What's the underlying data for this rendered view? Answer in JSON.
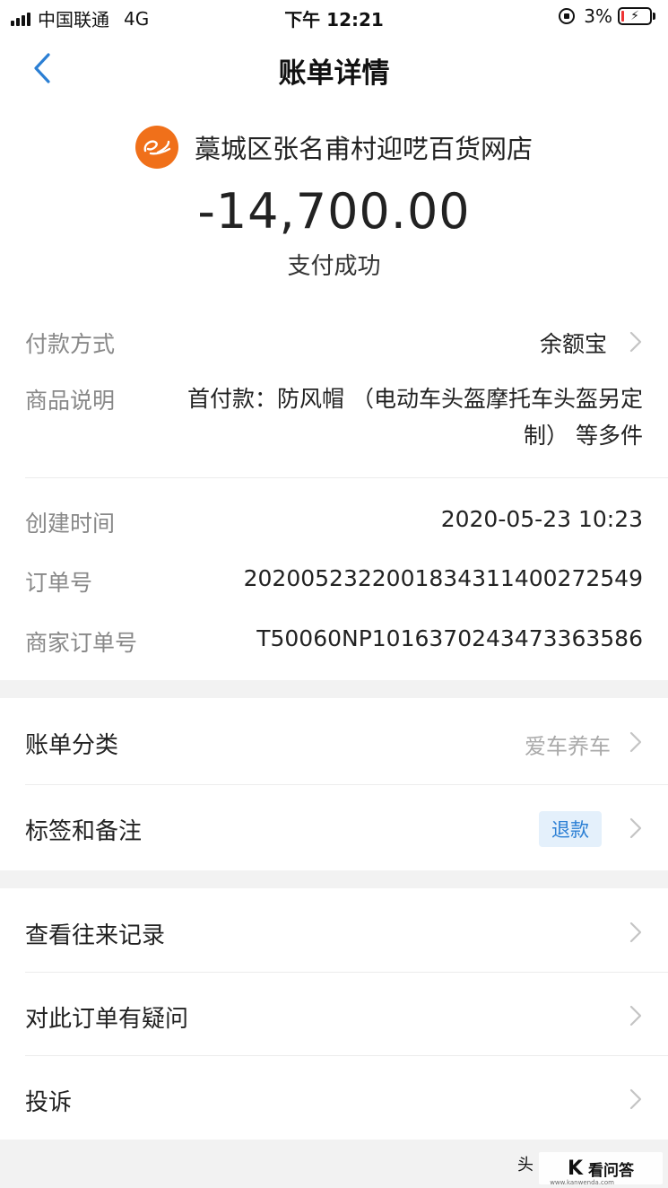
{
  "status_bar": {
    "carrier": "中国联通",
    "network": "4G",
    "time": "下午 12:21",
    "battery": "3%",
    "icons": [
      "signal-icon",
      "orientation-lock-icon",
      "battery-charging-icon"
    ]
  },
  "nav": {
    "title": "账单详情",
    "back_icon": "chevron-left-icon"
  },
  "merchant": {
    "name": "藁城区张名甫村迎呓百货网店",
    "logo_icon": "alibaba-logo-icon",
    "amount": "-14,700.00",
    "status": "支付成功"
  },
  "details": {
    "payment_method": {
      "label": "付款方式",
      "value": "余额宝"
    },
    "product_desc": {
      "label": "商品说明",
      "value_line1": "首付款：防风帽 （电动车头盔摩托车头盔另定",
      "value_line2": "制） 等多件"
    },
    "created_time": {
      "label": "创建时间",
      "value": "2020-05-23 10:23"
    },
    "order_no": {
      "label": "订单号",
      "value": "2020052322001834311400272549"
    },
    "merchant_order_no": {
      "label": "商家订单号",
      "value": "T50060NP1016370243473363586"
    }
  },
  "classification": {
    "category": {
      "label": "账单分类",
      "value": "爱车养车"
    },
    "tags": {
      "label": "标签和备注",
      "badge": "退款"
    }
  },
  "actions": {
    "history": "查看往来记录",
    "question": "对此订单有疑问",
    "complaint": "投诉"
  },
  "watermark": {
    "partial": "头",
    "brand": "看问答",
    "site": "www.kanwenda.com"
  },
  "colors": {
    "accent_blue": "#2b7fd4",
    "logo_orange": "#f0701a",
    "badge_bg": "#e4f0fb",
    "background": "#f2f2f2"
  }
}
